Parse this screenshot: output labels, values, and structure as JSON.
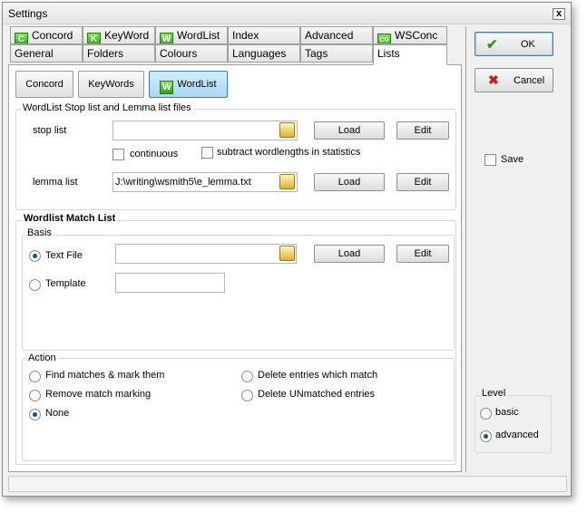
{
  "window": {
    "title": "Settings",
    "close_glyph": "x"
  },
  "tabs_row1": [
    {
      "label": "Concord",
      "icon": "C"
    },
    {
      "label": "KeyWord",
      "icon": "K"
    },
    {
      "label": "WordList",
      "icon": "W"
    },
    {
      "label": "Index",
      "icon": ""
    },
    {
      "label": "Advanced",
      "icon": ""
    },
    {
      "label": "WSConc",
      "icon": "CG"
    }
  ],
  "tabs_row2": [
    {
      "label": "General"
    },
    {
      "label": "Folders"
    },
    {
      "label": "Colours"
    },
    {
      "label": "Languages"
    },
    {
      "label": "Tags"
    },
    {
      "label": "Lists"
    }
  ],
  "subbuttons": {
    "concord": "Concord",
    "keywords": "KeyWords",
    "wordlist": "WordList",
    "wordlist_icon": "W"
  },
  "stoplemma": {
    "title": "WordList Stop list and Lemma list files",
    "stop_label": "stop list",
    "stop_value": "",
    "continuous_label": "continuous",
    "subtract_label": "subtract wordlengths in statistics",
    "lemma_label": "lemma list",
    "lemma_value": "J:\\writing\\wsmith5\\e_lemma.txt",
    "load_label": "Load",
    "edit_label": "Edit"
  },
  "matchlist": {
    "title": "Wordlist Match List",
    "basis_title": "Basis",
    "textfile_label": "Text File",
    "textfile_value": "",
    "template_label": "Template",
    "template_value": "",
    "load_label": "Load",
    "edit_label": "Edit",
    "action_title": "Action",
    "actions": [
      {
        "label": "Find matches & mark them",
        "checked": false
      },
      {
        "label": "Delete entries which match",
        "checked": false
      },
      {
        "label": "Remove match marking",
        "checked": false
      },
      {
        "label": "Delete UNmatched entries",
        "checked": false
      },
      {
        "label": "None",
        "checked": true
      }
    ]
  },
  "side": {
    "ok_label": "OK",
    "cancel_label": "Cancel",
    "save_label": "Save",
    "level_title": "Level",
    "level_basic": "basic",
    "level_advanced": "advanced"
  },
  "colors": {
    "ok_check": "#2e9a1e",
    "cancel_x": "#c8201a",
    "icon_green": "#3aaa22"
  }
}
